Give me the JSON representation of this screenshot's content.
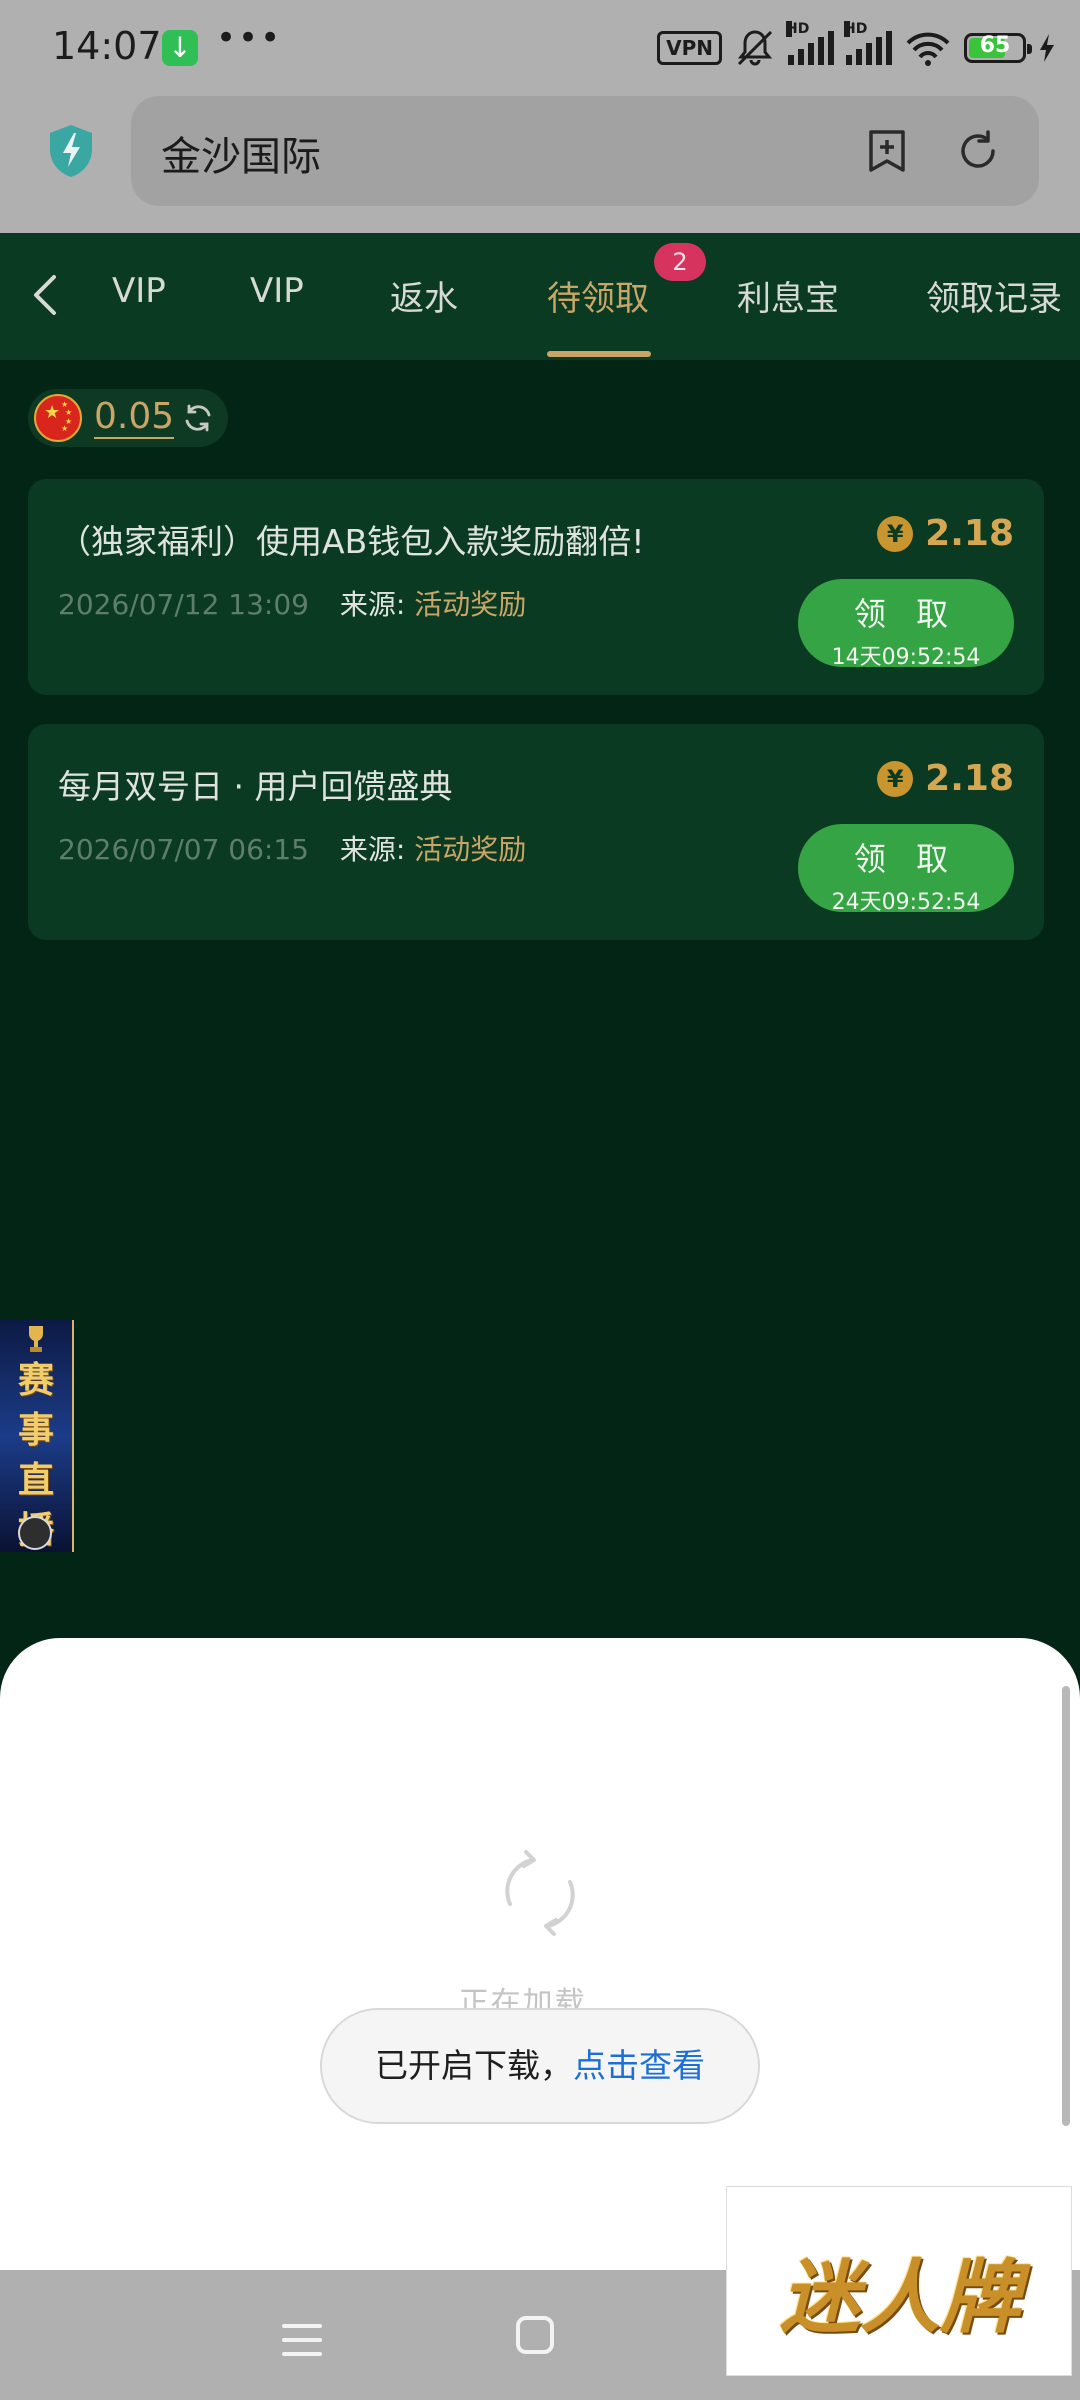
{
  "status_bar": {
    "time": "14:07",
    "vpn": "VPN",
    "hd": "HD",
    "battery": "65",
    "battery_level": 0.65,
    "icons": [
      "download-icon",
      "more-dots-icon",
      "vpn-icon",
      "mute-bell-icon",
      "signal-icon",
      "wifi-icon",
      "battery-icon",
      "charging-icon"
    ]
  },
  "browser": {
    "url_text": "金沙国际",
    "icons": [
      "shield-icon",
      "bookmark-add-icon",
      "reload-icon"
    ]
  },
  "tabs": {
    "items": [
      {
        "label": "VIP"
      },
      {
        "label": "VIP"
      },
      {
        "label": "返水"
      },
      {
        "label": "待领取",
        "badge": "2",
        "active": true
      },
      {
        "label": "利息宝"
      },
      {
        "label": "领取记录"
      }
    ]
  },
  "balance": {
    "value": "0.05"
  },
  "rewards": [
    {
      "title": "（独家福利）使用AB钱包入款奖励翻倍!",
      "amount": "2.18",
      "date": "2026/07/12 13:09",
      "source_label": "来源:",
      "source": "活动奖励",
      "claim_label": "领 取",
      "claim_timer": "14天09:52:54"
    },
    {
      "title": "每月双号日 · 用户回馈盛典",
      "amount": "2.18",
      "date": "2026/07/07 06:15",
      "source_label": "来源:",
      "source": "活动奖励",
      "claim_label": "领 取",
      "claim_timer": "24天09:52:54"
    }
  ],
  "promo_banner": {
    "text": "赛事直播"
  },
  "loading": {
    "text": "正在加载..."
  },
  "toast": {
    "message": "已开启下载，",
    "link": "点击查看"
  },
  "watermark": {
    "text": "迷人牌"
  },
  "colors": {
    "page_bg": "#032516",
    "card_bg": "#0b3a22",
    "gold": "#c9a568",
    "claim_green": "#35a444",
    "badge_pink": "#d6345e",
    "link_blue": "#1b6fd6"
  }
}
